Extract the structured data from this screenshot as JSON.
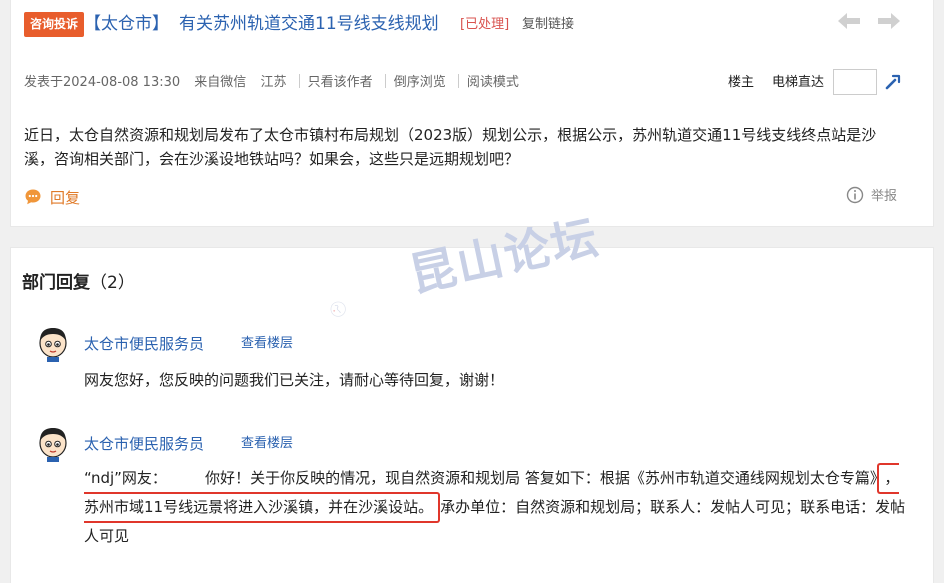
{
  "thread": {
    "badge": "咨询投诉",
    "city": "【太仓市】",
    "title": "有关苏州轨道交通11号线支线规划",
    "status": "[已处理]",
    "copy_link": "复制链接"
  },
  "meta": {
    "posted": "发表于2024-08-08 13:30",
    "source": "来自微信",
    "region": "江苏",
    "only_author": "只看该作者",
    "reverse": "倒序浏览",
    "reading_mode": "阅读模式",
    "floor_owner": "楼主",
    "elevator": "电梯直达",
    "floor_input_value": ""
  },
  "post": {
    "content": "近日，太仓自然资源和规划局发布了太仓市镇村布局规划（2023版）规划公示，根据公示，苏州轨道交通11号线支线终点站是沙溪，咨询相关部门，会在沙溪设地铁站吗？如果会，这些只是远期规划吧？",
    "reply_label": "回复",
    "report_label": "举报"
  },
  "department": {
    "title": "部门回复",
    "count": "（2）",
    "replies": [
      {
        "name": "太仓市便民服务员",
        "floor_link": "查看楼层",
        "text": "网友您好，您反映的问题我们已关注，请耐心等待回复，谢谢！"
      },
      {
        "name": "太仓市便民服务员",
        "floor_link": "查看楼层",
        "text_before": "“ndj”网友：        你好！关于你反映的情况，现自然资源和规划局 答复如下：根据《苏州市轨道交通线网规划太仓专篇》",
        "text_highlight": "，苏州市域11号线远景将进入沙溪镇，并在沙溪设站。",
        "text_after": "承办单位：自然资源和规划局；联系人：发帖人可见；联系电话：发帖人可见"
      }
    ]
  },
  "watermark": {
    "text": "昆山论坛"
  },
  "colors": {
    "link": "#2b62b0",
    "badge": "#e85d2c",
    "status": "#d9534f",
    "reply": "#e07a28",
    "highlight": "#e0362b"
  }
}
